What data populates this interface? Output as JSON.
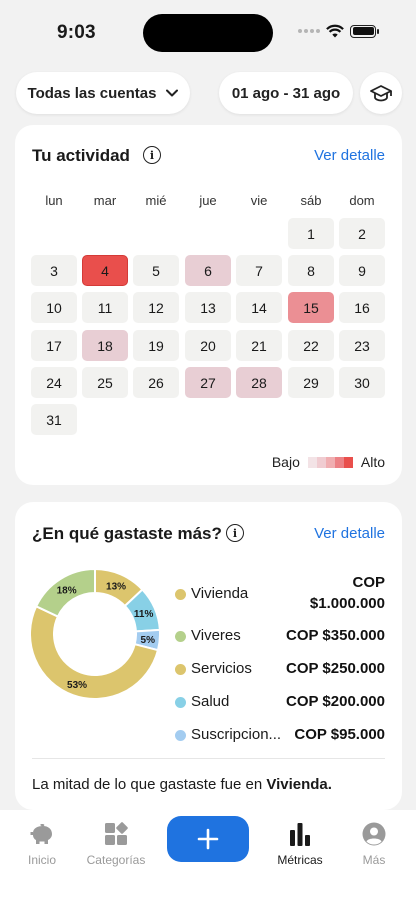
{
  "status_bar": {
    "time": "9:03"
  },
  "filters": {
    "account": "Todas las cuentas",
    "date_range": "01 ago - 31 ago",
    "learn_icon": "graduation-cap-icon"
  },
  "activity": {
    "title": "Tu actividad",
    "link": "Ver detalle",
    "weekdays": [
      "lun",
      "mar",
      "mié",
      "jue",
      "vie",
      "sáb",
      "dom"
    ],
    "days": [
      {
        "day": "1",
        "level": 0
      },
      {
        "day": "2",
        "level": 0
      },
      {
        "day": "3",
        "level": 0
      },
      {
        "day": "4",
        "level": 4
      },
      {
        "day": "5",
        "level": 0
      },
      {
        "day": "6",
        "level": 1
      },
      {
        "day": "7",
        "level": 0
      },
      {
        "day": "8",
        "level": 0
      },
      {
        "day": "9",
        "level": 0
      },
      {
        "day": "10",
        "level": 0
      },
      {
        "day": "11",
        "level": 0
      },
      {
        "day": "12",
        "level": 0
      },
      {
        "day": "13",
        "level": 0
      },
      {
        "day": "14",
        "level": 0
      },
      {
        "day": "15",
        "level": 3
      },
      {
        "day": "16",
        "level": 0
      },
      {
        "day": "17",
        "level": 0
      },
      {
        "day": "18",
        "level": 1
      },
      {
        "day": "19",
        "level": 0
      },
      {
        "day": "20",
        "level": 0
      },
      {
        "day": "21",
        "level": 0
      },
      {
        "day": "22",
        "level": 0
      },
      {
        "day": "23",
        "level": 0
      },
      {
        "day": "24",
        "level": 0
      },
      {
        "day": "25",
        "level": 0
      },
      {
        "day": "26",
        "level": 0
      },
      {
        "day": "27",
        "level": 1
      },
      {
        "day": "28",
        "level": 1
      },
      {
        "day": "29",
        "level": 0
      },
      {
        "day": "30",
        "level": 0
      },
      {
        "day": "31",
        "level": 0
      }
    ],
    "first_weekday_index": 5,
    "level_colors": [
      "#f2f2f0",
      "#e8ced4",
      "#f0b4b8",
      "#eb8f94",
      "#e94f4c"
    ],
    "legend_low": "Bajo",
    "legend_high": "Alto"
  },
  "spending": {
    "title": "¿En qué gastaste más?",
    "link": "Ver detalle",
    "categories": [
      {
        "name": "Vivienda",
        "amount_line1": "COP",
        "amount_line2": "$1.000.000",
        "percent": 53,
        "color": "#dcc56d"
      },
      {
        "name": "Viveres",
        "amount": "COP $350.000",
        "percent": 18,
        "color": "#b4d08b"
      },
      {
        "name": "Servicios",
        "amount": "COP $250.000",
        "percent": 13,
        "color": "#dcc56d"
      },
      {
        "name": "Salud",
        "amount": "COP $200.000",
        "percent": 11,
        "color": "#88d0e6"
      },
      {
        "name": "Suscripcion...",
        "amount": "COP $95.000",
        "percent": 5,
        "color": "#a3ccf0"
      }
    ],
    "donut_labels": [
      "53%",
      "18%",
      "13%",
      "11%",
      "5%"
    ],
    "summary_prefix": "La mitad de lo que gastaste fue en ",
    "summary_highlight": "Vivienda."
  },
  "nav": {
    "items": [
      {
        "label": "Inicio",
        "icon": "piggy-bank-icon"
      },
      {
        "label": "Categorías",
        "icon": "categories-icon"
      },
      {
        "label": "Métricas",
        "icon": "bar-chart-icon"
      },
      {
        "label": "Más",
        "icon": "profile-icon"
      }
    ],
    "add_icon": "plus-icon",
    "active_color": "#1f73e0"
  }
}
